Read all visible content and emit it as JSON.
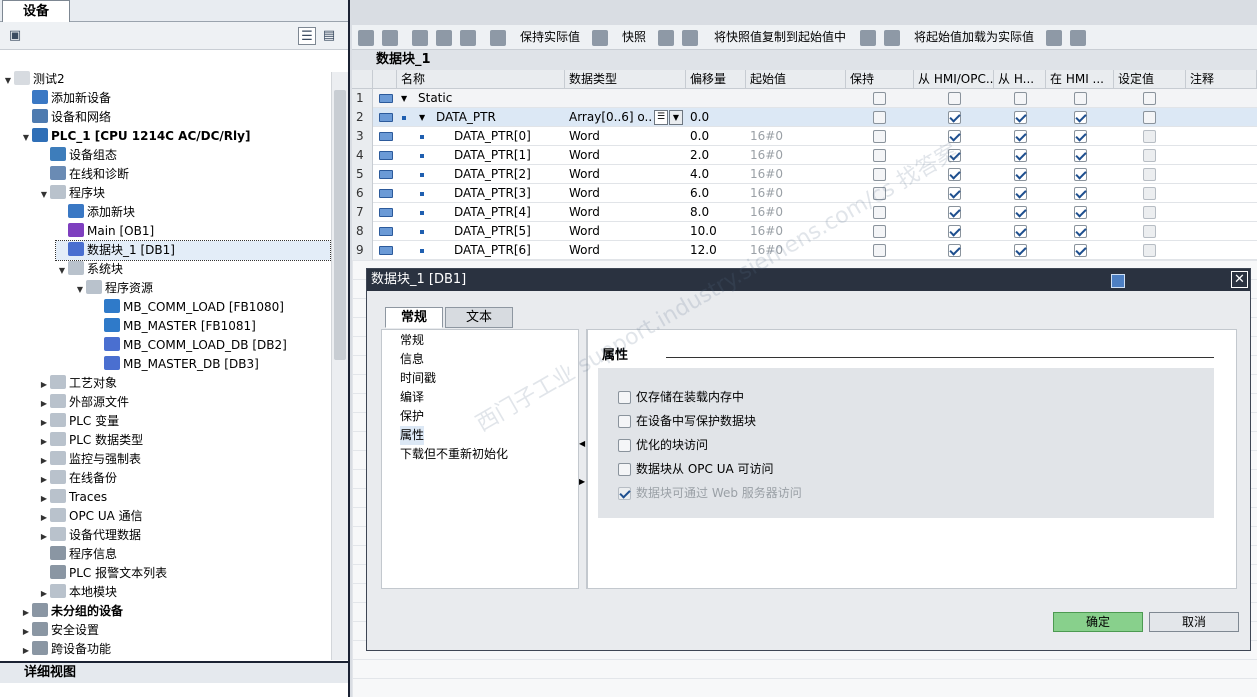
{
  "left_panel": {
    "tab": "设备",
    "tree": [
      {
        "label": "测试2",
        "level": 0,
        "arrow": "down",
        "icon": "project-icon",
        "color": "#d7dbe0"
      },
      {
        "label": "添加新设备",
        "level": 1,
        "arrow": "",
        "icon": "add-device-icon",
        "color": "#3a78c4"
      },
      {
        "label": "设备和网络",
        "level": 1,
        "arrow": "",
        "icon": "network-icon",
        "color": "#4e7bb0"
      },
      {
        "label": "PLC_1 [CPU 1214C AC/DC/Rly]",
        "level": 1,
        "arrow": "down",
        "icon": "plc-icon",
        "color": "#2f6fb7",
        "bold": true
      },
      {
        "label": "设备组态",
        "level": 2,
        "arrow": "",
        "icon": "device-config-icon",
        "color": "#3d7dbb"
      },
      {
        "label": "在线和诊断",
        "level": 2,
        "arrow": "",
        "icon": "online-diag-icon",
        "color": "#6a8bb4"
      },
      {
        "label": "程序块",
        "level": 2,
        "arrow": "down",
        "icon": "folder-icon",
        "color": "#b9c2cc"
      },
      {
        "label": "添加新块",
        "level": 3,
        "arrow": "",
        "icon": "add-block-icon",
        "color": "#3a78c4"
      },
      {
        "label": "Main [OB1]",
        "level": 3,
        "arrow": "",
        "icon": "ob-icon",
        "color": "#7e3fbf"
      },
      {
        "label": "数据块_1 [DB1]",
        "level": 3,
        "arrow": "",
        "icon": "db-icon",
        "color": "#4a6fd0",
        "selected": true
      },
      {
        "label": "系统块",
        "level": 3,
        "arrow": "down",
        "icon": "folder-icon",
        "color": "#b9c2cc"
      },
      {
        "label": "程序资源",
        "level": 4,
        "arrow": "down",
        "icon": "folder-icon",
        "color": "#b9c2cc"
      },
      {
        "label": "MB_COMM_LOAD [FB1080]",
        "level": 5,
        "arrow": "",
        "icon": "fb-icon",
        "color": "#2f7ac9"
      },
      {
        "label": "MB_MASTER [FB1081]",
        "level": 5,
        "arrow": "",
        "icon": "fb-icon",
        "color": "#2f7ac9"
      },
      {
        "label": "MB_COMM_LOAD_DB [DB2]",
        "level": 5,
        "arrow": "",
        "icon": "db-icon",
        "color": "#4a6fd0"
      },
      {
        "label": "MB_MASTER_DB [DB3]",
        "level": 5,
        "arrow": "",
        "icon": "db-icon",
        "color": "#4a6fd0"
      },
      {
        "label": "工艺对象",
        "level": 2,
        "arrow": "right",
        "icon": "tech-object-icon",
        "color": "#b9c2cc"
      },
      {
        "label": "外部源文件",
        "level": 2,
        "arrow": "right",
        "icon": "external-source-icon",
        "color": "#b9c2cc"
      },
      {
        "label": "PLC 变量",
        "level": 2,
        "arrow": "right",
        "icon": "plc-tags-icon",
        "color": "#b9c2cc"
      },
      {
        "label": "PLC 数据类型",
        "level": 2,
        "arrow": "right",
        "icon": "plc-datatype-icon",
        "color": "#b9c2cc"
      },
      {
        "label": "监控与强制表",
        "level": 2,
        "arrow": "right",
        "icon": "watch-table-icon",
        "color": "#b9c2cc"
      },
      {
        "label": "在线备份",
        "level": 2,
        "arrow": "right",
        "icon": "online-backup-icon",
        "color": "#b9c2cc"
      },
      {
        "label": "Traces",
        "level": 2,
        "arrow": "right",
        "icon": "traces-icon",
        "color": "#b9c2cc"
      },
      {
        "label": "OPC UA 通信",
        "level": 2,
        "arrow": "right",
        "icon": "opc-ua-icon",
        "color": "#b9c2cc"
      },
      {
        "label": "设备代理数据",
        "level": 2,
        "arrow": "right",
        "icon": "proxy-data-icon",
        "color": "#b9c2cc"
      },
      {
        "label": "程序信息",
        "level": 2,
        "arrow": "",
        "icon": "program-info-icon",
        "color": "#8a96a3"
      },
      {
        "label": "PLC 报警文本列表",
        "level": 2,
        "arrow": "",
        "icon": "alarm-text-icon",
        "color": "#8a96a3"
      },
      {
        "label": "本地模块",
        "level": 2,
        "arrow": "right",
        "icon": "local-modules-icon",
        "color": "#b9c2cc"
      },
      {
        "label": "未分组的设备",
        "level": 1,
        "arrow": "right",
        "icon": "ungrouped-devices-icon",
        "color": "#8a96a3",
        "bold": true
      },
      {
        "label": "安全设置",
        "level": 1,
        "arrow": "right",
        "icon": "security-icon",
        "color": "#8a96a3"
      },
      {
        "label": "跨设备功能",
        "level": 1,
        "arrow": "right",
        "icon": "cross-device-icon",
        "color": "#8a96a3"
      }
    ],
    "detail_view": "详细视图"
  },
  "toolbar": {
    "keep_actual": "保持实际值",
    "snapshot": "快照",
    "copy_snapshot": "将快照值复制到起始值中",
    "load_start": "将起始值加载为实际值"
  },
  "block_title": "数据块_1",
  "grid": {
    "columns": [
      "名称",
      "数据类型",
      "偏移量",
      "起始值",
      "保持",
      "从 HMI/OPC...",
      "从 H...",
      "在 HMI ...",
      "设定值",
      "注释"
    ],
    "rows": [
      {
        "num": "1",
        "name": "Static",
        "indent": 0,
        "arrow": "down",
        "type": "",
        "offset": "",
        "start": "",
        "keep": false,
        "hmi1": false,
        "hmi2": false,
        "hmi3": false,
        "set": false,
        "header": true
      },
      {
        "num": "2",
        "name": "DATA_PTR",
        "indent": 1,
        "arrow": "down",
        "type": "Array[0..6] o...",
        "offset": "0.0",
        "start": "",
        "keep": false,
        "hmi1": true,
        "hmi2": true,
        "hmi3": true,
        "set": false,
        "selected": true
      },
      {
        "num": "3",
        "name": "DATA_PTR[0]",
        "indent": 2,
        "arrow": "",
        "type": "Word",
        "offset": "0.0",
        "start": "16#0",
        "keep": false,
        "hmi1": true,
        "hmi2": true,
        "hmi3": true,
        "set": false
      },
      {
        "num": "4",
        "name": "DATA_PTR[1]",
        "indent": 2,
        "arrow": "",
        "type": "Word",
        "offset": "2.0",
        "start": "16#0",
        "keep": false,
        "hmi1": true,
        "hmi2": true,
        "hmi3": true,
        "set": false
      },
      {
        "num": "5",
        "name": "DATA_PTR[2]",
        "indent": 2,
        "arrow": "",
        "type": "Word",
        "offset": "4.0",
        "start": "16#0",
        "keep": false,
        "hmi1": true,
        "hmi2": true,
        "hmi3": true,
        "set": false
      },
      {
        "num": "6",
        "name": "DATA_PTR[3]",
        "indent": 2,
        "arrow": "",
        "type": "Word",
        "offset": "6.0",
        "start": "16#0",
        "keep": false,
        "hmi1": true,
        "hmi2": true,
        "hmi3": true,
        "set": false
      },
      {
        "num": "7",
        "name": "DATA_PTR[4]",
        "indent": 2,
        "arrow": "",
        "type": "Word",
        "offset": "8.0",
        "start": "16#0",
        "keep": false,
        "hmi1": true,
        "hmi2": true,
        "hmi3": true,
        "set": false
      },
      {
        "num": "8",
        "name": "DATA_PTR[5]",
        "indent": 2,
        "arrow": "",
        "type": "Word",
        "offset": "10.0",
        "start": "16#0",
        "keep": false,
        "hmi1": true,
        "hmi2": true,
        "hmi3": true,
        "set": false
      },
      {
        "num": "9",
        "name": "DATA_PTR[6]",
        "indent": 2,
        "arrow": "",
        "type": "Word",
        "offset": "12.0",
        "start": "16#0",
        "keep": false,
        "hmi1": true,
        "hmi2": true,
        "hmi3": true,
        "set": false
      }
    ]
  },
  "dialog": {
    "title": "数据块_1 [DB1]",
    "close": "✕",
    "tabs": [
      "常规",
      "文本"
    ],
    "nav": [
      "常规",
      "信息",
      "时间戳",
      "编译",
      "保护",
      "属性",
      "下载但不重新初始化"
    ],
    "selected_nav": "属性",
    "section_title": "属性",
    "options": [
      {
        "label": "仅存储在装载内存中",
        "checked": false,
        "disabled": false
      },
      {
        "label": "在设备中写保护数据块",
        "checked": false,
        "disabled": false
      },
      {
        "label": "优化的块访问",
        "checked": false,
        "disabled": false
      },
      {
        "label": "数据块从 OPC UA 可访问",
        "checked": false,
        "disabled": false
      },
      {
        "label": "数据块可通过 Web 服务器访问",
        "checked": true,
        "disabled": true
      }
    ],
    "ok": "确定",
    "cancel": "取消"
  },
  "watermark": "西门子工业 support.industry.siemens.com/cs 找答案"
}
